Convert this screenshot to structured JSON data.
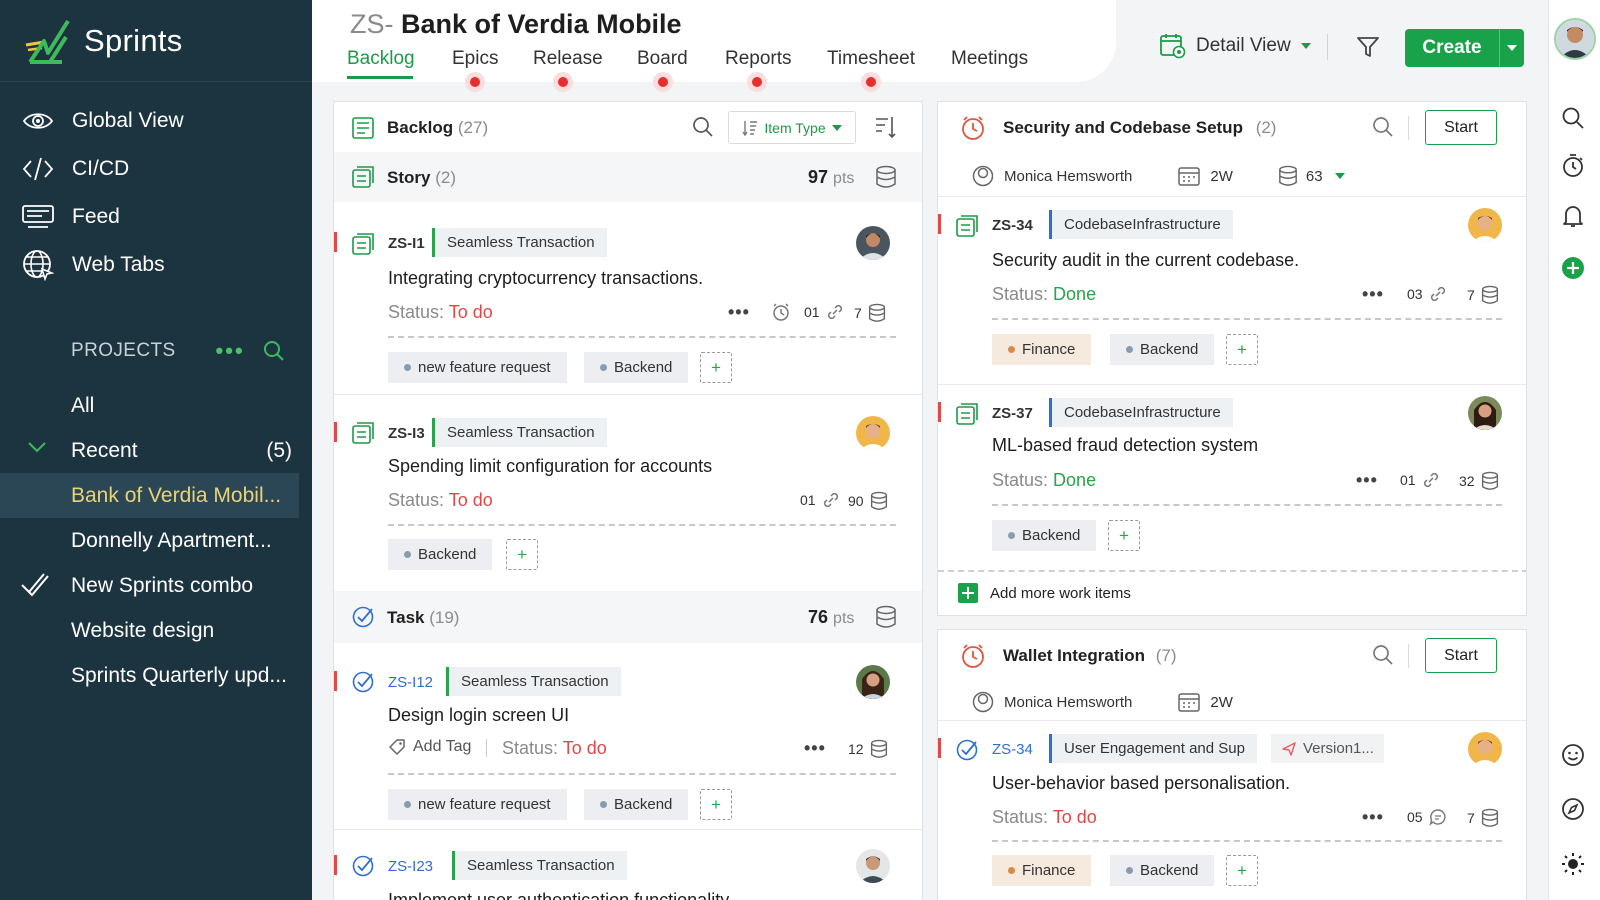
{
  "app": {
    "name": "Sprints"
  },
  "sidebar": {
    "nav": [
      {
        "label": "Global View",
        "icon": "eye-icon"
      },
      {
        "label": "CI/CD",
        "icon": "code-icon"
      },
      {
        "label": "Feed",
        "icon": "feed-icon"
      },
      {
        "label": "Web Tabs",
        "icon": "globe-icon"
      }
    ],
    "projects_label": "PROJECTS",
    "projects": {
      "all": "All",
      "recent": "Recent",
      "recent_count": "(5)",
      "items": [
        "Bank of Verdia Mobil...",
        "Donnelly Apartment...",
        "New Sprints combo",
        "Website design",
        "Sprints Quarterly upd..."
      ]
    }
  },
  "header": {
    "prefix": "ZS-",
    "title": "Bank of Verdia Mobile",
    "tabs": [
      "Backlog",
      "Epics",
      "Release",
      "Board",
      "Reports",
      "Timesheet",
      "Meetings"
    ],
    "active_tab": "Backlog"
  },
  "toolbar": {
    "view_label": "Detail View",
    "create_label": "Create"
  },
  "backlog": {
    "title": "Backlog",
    "count": "(27)",
    "filter_label": "Item Type",
    "story_group": {
      "label": "Story",
      "count": "(2)",
      "points": "97",
      "points_unit": "pts"
    },
    "task_group": {
      "label": "Task",
      "count": "(19)",
      "points": "76",
      "points_unit": "pts"
    },
    "status_label": "Status:",
    "items": [
      {
        "id": "ZS-I1",
        "epic": "Seamless Transaction",
        "title": "Integrating cryptocurrency transactions.",
        "status": "To do",
        "links": "01",
        "points": "7",
        "tags": [
          "new feature request",
          "Backend"
        ]
      },
      {
        "id": "ZS-I3",
        "epic": "Seamless Transaction",
        "title": "Spending limit configuration for accounts",
        "status": "To do",
        "links": "01",
        "points": "90",
        "tags": [
          "Backend"
        ]
      },
      {
        "id": "ZS-I12",
        "epic": "Seamless Transaction",
        "title": "Design login screen UI",
        "add_tag": "Add Tag",
        "status": "To do",
        "points": "12",
        "tags": [
          "new feature request",
          "Backend"
        ]
      },
      {
        "id": "ZS-I23",
        "epic": "Seamless Transaction",
        "title": "Implement user authentication functionality"
      }
    ]
  },
  "sprints": [
    {
      "title": "Security and Codebase Setup",
      "count": "(2)",
      "start": "Start",
      "owner": "Monica Hemsworth",
      "duration": "2W",
      "points": "63",
      "items": [
        {
          "id": "ZS-34",
          "epic": "CodebaseInfrastructure",
          "title": "Security audit in the current codebase.",
          "status": "Done",
          "links": "03",
          "points": "7",
          "tags": [
            "Finance",
            "Backend"
          ]
        },
        {
          "id": "ZS-37",
          "epic": "CodebaseInfrastructure",
          "title": "ML-based fraud detection system",
          "status": "Done",
          "links": "01",
          "points": "32",
          "tags": [
            "Backend"
          ]
        }
      ],
      "add_more": "Add more work items"
    },
    {
      "title": "Wallet Integration",
      "count": "(7)",
      "start": "Start",
      "owner": "Monica Hemsworth",
      "duration": "2W",
      "items": [
        {
          "id": "ZS-34",
          "epic": "User Engagement and Sup",
          "release": "Version1...",
          "title": "User-behavior based personalisation.",
          "status": "To do",
          "comments": "05",
          "points": "7",
          "tags": [
            "Finance",
            "Backend"
          ]
        }
      ]
    }
  ],
  "colors": {
    "sidebar": "#1c3340",
    "accent": "#1aa24a",
    "todo": "#e04848",
    "done": "#2aa34a"
  }
}
